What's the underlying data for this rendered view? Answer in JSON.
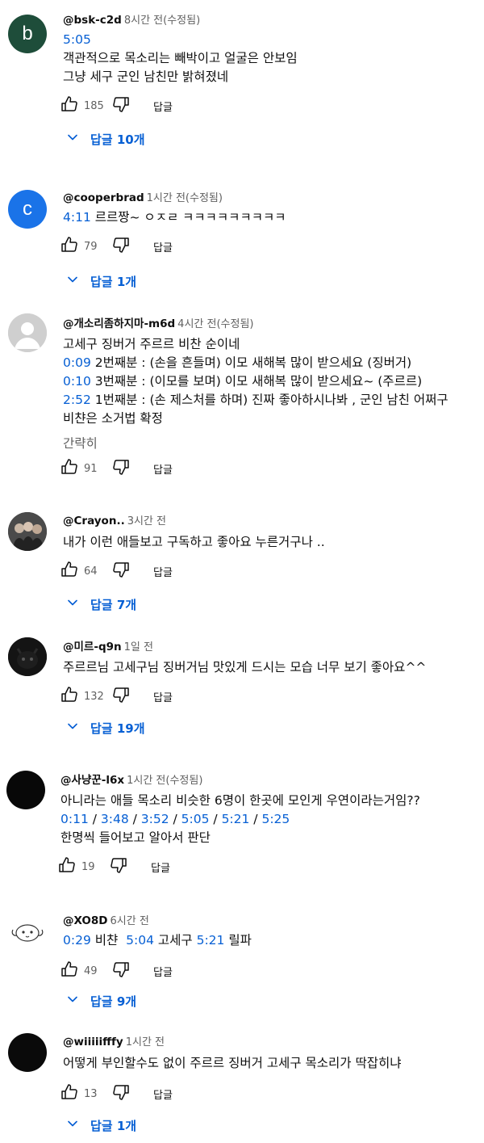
{
  "labels": {
    "reply": "답글"
  },
  "comments": [
    {
      "author": "@bsk-c2d",
      "time": "8시간 전(수정됨)",
      "avatar": {
        "letter": "b",
        "color": "#1e4d3a"
      },
      "lines": [
        [
          {
            "t": "5:05",
            "ts": true
          }
        ],
        [
          {
            "t": "객관적으로 목소리는 빼박이고 얼굴은 안보임"
          }
        ],
        [
          {
            "t": "그냥 세구 군인 남친만 밝혀졌네"
          }
        ]
      ],
      "likes": "185",
      "replies": "답글 10개"
    },
    {
      "author": "@cooperbrad",
      "time": "1시간 전(수정됨)",
      "avatar": {
        "letter": "c",
        "color": "#1a73e8"
      },
      "lines": [
        [
          {
            "t": "4:11",
            "ts": true
          },
          {
            "t": " 르르짱~ ㅇㅈㄹ ㅋㅋㅋㅋㅋㅋㅋㅋㅋ"
          }
        ]
      ],
      "likes": "79",
      "replies": "답글 1개"
    },
    {
      "author": "@개소리좀하지마-m6d",
      "time": "4시간 전(수정됨)",
      "avatar": {
        "letter": "",
        "color": "#cfcfcf"
      },
      "lines": [
        [
          {
            "t": "고세구 징버거 주르르 비찬 순이네"
          }
        ],
        [
          {
            "t": "0:09",
            "ts": true
          },
          {
            "t": " 2번째분 : (손을 흔들며) 이모 새해복 많이 받으세요 (징버거)"
          }
        ],
        [
          {
            "t": "0:10",
            "ts": true
          },
          {
            "t": " 3번째분 : (이모를 보며) 이모 새해복 많이 받으세요~ (주르르)"
          }
        ],
        [
          {
            "t": "2:52",
            "ts": true
          },
          {
            "t": " 1번째분 : (손 제스처를 하며) 진짜 좋아하시나봐 , 군인 남친 어쩌구"
          }
        ],
        [
          {
            "t": "비챤은 소거법 확정"
          }
        ]
      ],
      "more": "간략히",
      "likes": "91",
      "replies": ""
    },
    {
      "author": "@Crayon..",
      "time": "3시간 전",
      "avatar": {
        "letter": "",
        "color": "#3a3a3a"
      },
      "lines": [
        [
          {
            "t": "내가 이런 애들보고 구독하고 좋아요 누른거구나 .."
          }
        ]
      ],
      "likes": "64",
      "replies": "답글 7개"
    },
    {
      "author": "@미르-q9n",
      "time": "1일 전",
      "avatar": {
        "letter": "",
        "color": "#141414"
      },
      "lines": [
        [
          {
            "t": "주르르님 고세구님 징버거님 맛있게 드시는 모습 너무 보기 좋아요^^"
          }
        ]
      ],
      "likes": "132",
      "replies": "답글 19개"
    },
    {
      "author": "@사냥꾼-l6x",
      "time": "1시간 전(수정됨)",
      "avatar": {
        "letter": "",
        "color": "#080808"
      },
      "lines": [
        [
          {
            "t": "아니라는 애들 목소리 비슷한 6명이 한곳에 모인게 우연이라는거임??"
          }
        ],
        [
          {
            "t": "0:11",
            "ts": true
          },
          {
            "t": " / "
          },
          {
            "t": "3:48",
            "ts": true
          },
          {
            "t": " / "
          },
          {
            "t": "3:52",
            "ts": true
          },
          {
            "t": " / "
          },
          {
            "t": "5:05",
            "ts": true
          },
          {
            "t": " / "
          },
          {
            "t": "5:21",
            "ts": true
          },
          {
            "t": " / "
          },
          {
            "t": "5:25",
            "ts": true
          }
        ],
        [
          {
            "t": "한명씩 들어보고 알아서 판단"
          }
        ]
      ],
      "likes": "19",
      "replies": ""
    },
    {
      "author": "@XO8D",
      "time": "6시간 전",
      "avatar": {
        "letter": "",
        "color": "#ffffff"
      },
      "lines": [
        [
          {
            "t": "0:29",
            "ts": true
          },
          {
            "t": " 비챤  "
          },
          {
            "t": "5:04",
            "ts": true
          },
          {
            "t": " 고세구 "
          },
          {
            "t": "5:21",
            "ts": true
          },
          {
            "t": " 릴파"
          }
        ]
      ],
      "likes": "49",
      "replies": "답글 9개"
    },
    {
      "author": "@wiiiiifffy",
      "time": "1시간 전",
      "avatar": {
        "letter": "",
        "color": "#0a0a0a"
      },
      "lines": [
        [
          {
            "t": "어떻게 부인할수도 없이 주르르 징버거 고세구 목소리가 딱잡히냐"
          }
        ]
      ],
      "likes": "13",
      "replies": "답글 1개"
    }
  ]
}
